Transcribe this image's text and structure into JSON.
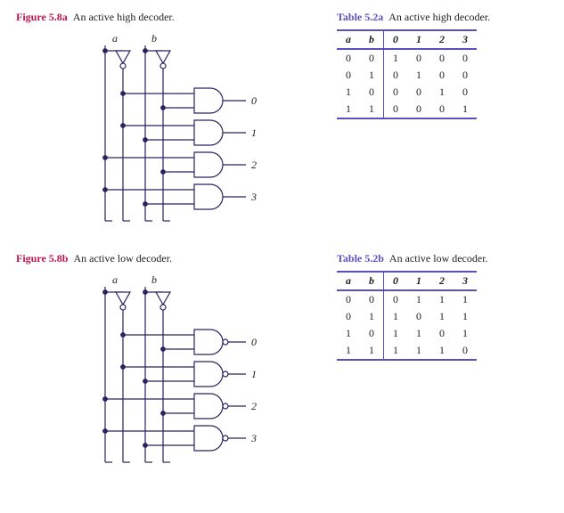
{
  "fig_a": {
    "id": "Figure 5.8a",
    "caption": "An active high decoder.",
    "inputs": {
      "a": "a",
      "b": "b"
    },
    "outputs": {
      "o0": "0",
      "o1": "1",
      "o2": "2",
      "o3": "3"
    }
  },
  "fig_b": {
    "id": "Figure 5.8b",
    "caption": "An active low decoder.",
    "inputs": {
      "a": "a",
      "b": "b"
    },
    "outputs": {
      "o0": "0",
      "o1": "1",
      "o2": "2",
      "o3": "3"
    }
  },
  "tab_a": {
    "id": "Table 5.2a",
    "caption": "An active high decoder.",
    "headers": {
      "a": "a",
      "b": "b",
      "c0": "0",
      "c1": "1",
      "c2": "2",
      "c3": "3"
    },
    "rows": [
      {
        "a": "0",
        "b": "0",
        "c0": "1",
        "c1": "0",
        "c2": "0",
        "c3": "0"
      },
      {
        "a": "0",
        "b": "1",
        "c0": "0",
        "c1": "1",
        "c2": "0",
        "c3": "0"
      },
      {
        "a": "1",
        "b": "0",
        "c0": "0",
        "c1": "0",
        "c2": "1",
        "c3": "0"
      },
      {
        "a": "1",
        "b": "1",
        "c0": "0",
        "c1": "0",
        "c2": "0",
        "c3": "1"
      }
    ]
  },
  "tab_b": {
    "id": "Table 5.2b",
    "caption": "An active low decoder.",
    "headers": {
      "a": "a",
      "b": "b",
      "c0": "0",
      "c1": "1",
      "c2": "2",
      "c3": "3"
    },
    "rows": [
      {
        "a": "0",
        "b": "0",
        "c0": "0",
        "c1": "1",
        "c2": "1",
        "c3": "1"
      },
      {
        "a": "0",
        "b": "1",
        "c0": "1",
        "c1": "0",
        "c2": "1",
        "c3": "1"
      },
      {
        "a": "1",
        "b": "0",
        "c0": "1",
        "c1": "1",
        "c2": "0",
        "c3": "1"
      },
      {
        "a": "1",
        "b": "1",
        "c0": "1",
        "c1": "1",
        "c2": "1",
        "c3": "0"
      }
    ]
  }
}
